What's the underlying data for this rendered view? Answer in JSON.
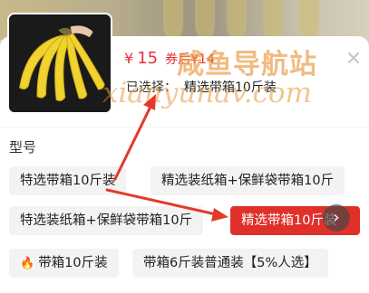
{
  "product": {
    "price_currency": "¥",
    "price_value": "15",
    "price_after_coupon": "券后¥14",
    "selected_label": "已选择：",
    "selected_value": "精选带箱10斤装"
  },
  "close_icon": "close-icon",
  "watermark": {
    "text": "咸鱼导航站",
    "url": "xianyunav.com"
  },
  "spec": {
    "title": "型号",
    "options": [
      {
        "label": "特选带箱10斤装",
        "selected": false,
        "hot": false
      },
      {
        "label": "精选装纸箱+保鲜袋带箱10斤",
        "selected": false,
        "hot": false
      },
      {
        "label": "特选装纸箱+保鲜袋带箱10斤",
        "selected": false,
        "hot": false
      },
      {
        "label": "精选带箱10斤装",
        "selected": true,
        "hot": false
      },
      {
        "label": "带箱10斤装",
        "selected": false,
        "hot": true
      },
      {
        "label": "带箱6斤装普通装【5%人选】",
        "selected": false,
        "hot": false
      }
    ]
  },
  "colors": {
    "accent": "#e0302a",
    "price": "#e8303a",
    "arrow": "#e23a2a"
  }
}
